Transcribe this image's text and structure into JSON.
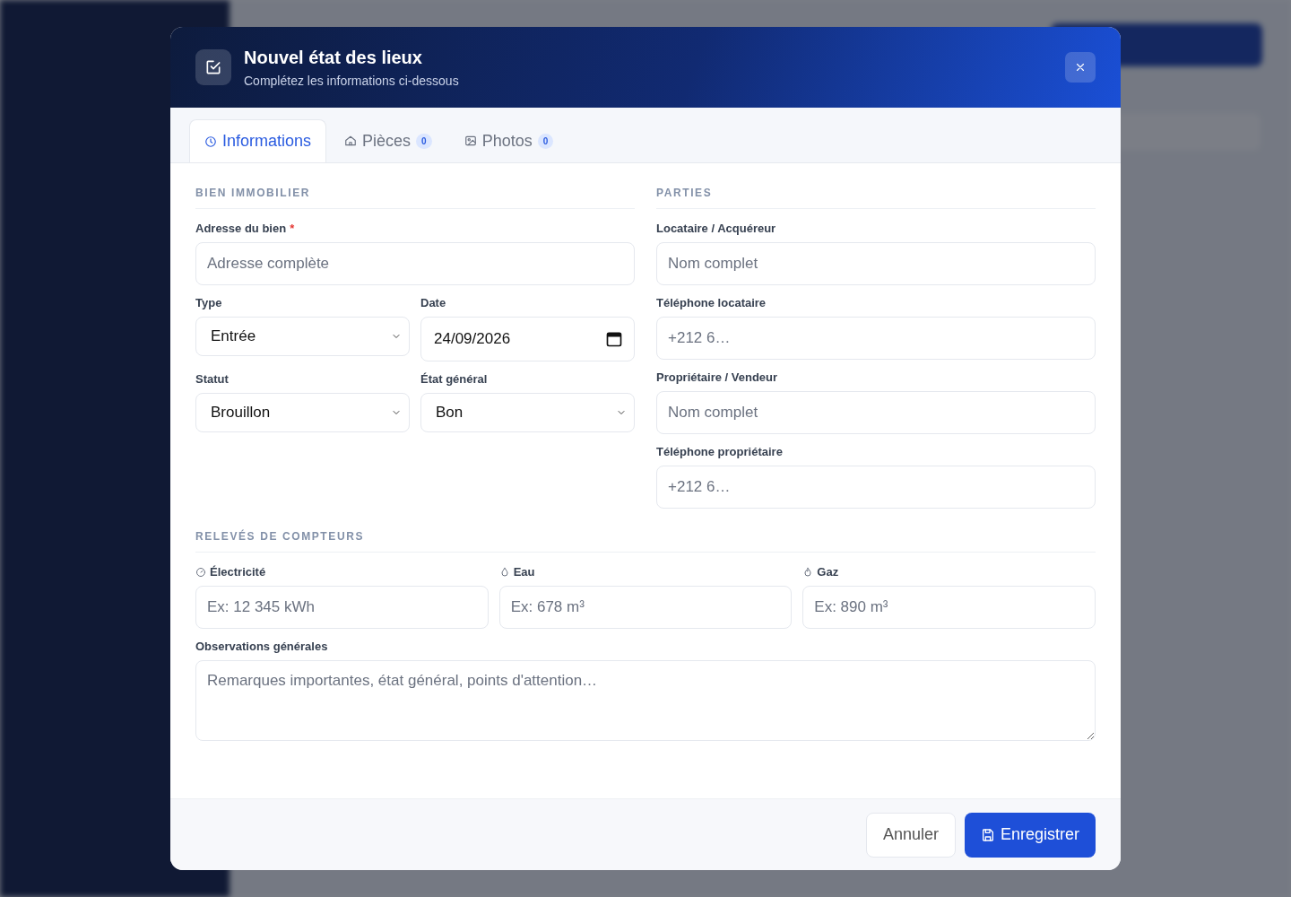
{
  "dialog": {
    "title": "Nouvel état des lieux",
    "subtitle": "Complétez les informations ci-dessous"
  },
  "tabs": [
    {
      "label": "Informations",
      "selected": true
    },
    {
      "label": "Pièces",
      "badge": "0",
      "selected": false
    },
    {
      "label": "Photos",
      "badge": "0",
      "selected": false
    }
  ],
  "property_section": {
    "heading": "BIEN IMMOBILIER",
    "address": {
      "label": "Adresse du bien",
      "required_mark": "*",
      "placeholder": "Adresse complète"
    },
    "type": {
      "label": "Type",
      "value": "Entrée"
    },
    "date": {
      "label": "Date",
      "value": "24/09/2026"
    },
    "status": {
      "label": "Statut",
      "value": "Brouillon"
    },
    "condition": {
      "label": "État général",
      "value": "Bon"
    }
  },
  "parties_section": {
    "heading": "PARTIES",
    "fields": [
      {
        "label": "Locataire / Acquéreur",
        "placeholder": "Nom complet"
      },
      {
        "label": "Téléphone locataire",
        "placeholder": "+212 6…"
      },
      {
        "label": "Propriétaire / Vendeur",
        "placeholder": "Nom complet"
      },
      {
        "label": "Téléphone propriétaire",
        "placeholder": "+212 6…"
      }
    ]
  },
  "meters_section": {
    "heading": "RELEVÉS DE COMPTEURS",
    "meters": [
      {
        "label": "Électricité",
        "placeholder": "Ex: 12 345 kWh"
      },
      {
        "label": "Eau",
        "placeholder": "Ex: 678 m³"
      },
      {
        "label": "Gaz",
        "placeholder": "Ex: 890 m³"
      }
    ]
  },
  "observations": {
    "label": "Observations générales",
    "placeholder": "Remarques importantes, état général, points d'attention…"
  },
  "buttons": [
    {
      "label": "Annuler",
      "kind": "secondary"
    },
    {
      "label": "Enregistrer",
      "kind": "primary"
    }
  ]
}
